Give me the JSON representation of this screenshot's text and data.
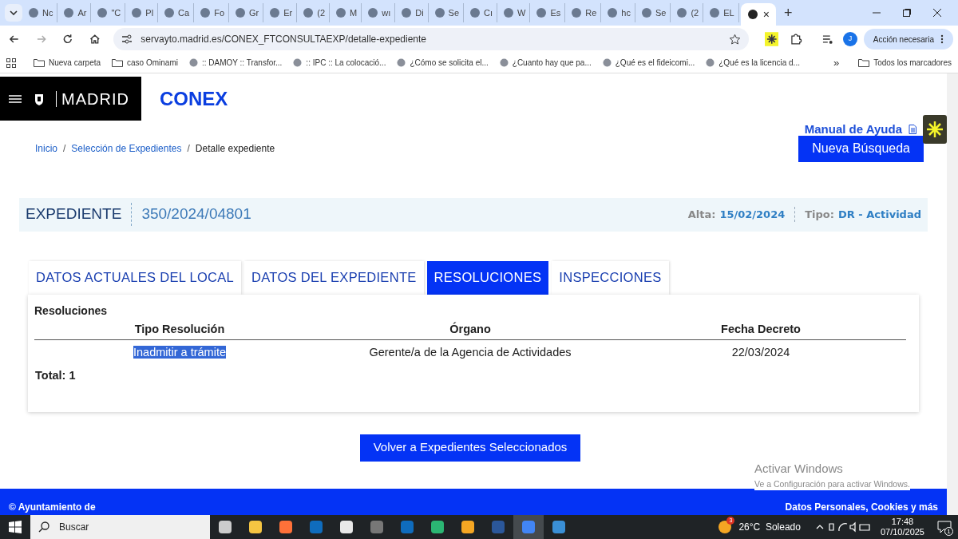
{
  "browser": {
    "tabs": [
      {
        "label": "Nc",
        "selected": false
      },
      {
        "label": "Ar",
        "selected": false
      },
      {
        "label": "\"C",
        "selected": false
      },
      {
        "label": "Pl",
        "selected": false
      },
      {
        "label": "Ca",
        "selected": false
      },
      {
        "label": "Fo",
        "selected": false
      },
      {
        "label": "Gr",
        "selected": false
      },
      {
        "label": "Er",
        "selected": false
      },
      {
        "label": "(2",
        "selected": false
      },
      {
        "label": "M",
        "selected": false
      },
      {
        "label": "wı",
        "selected": false
      },
      {
        "label": "Di",
        "selected": false
      },
      {
        "label": "Se",
        "selected": false
      },
      {
        "label": "Cı",
        "selected": false
      },
      {
        "label": "W",
        "selected": false
      },
      {
        "label": "Es",
        "selected": false
      },
      {
        "label": "Re",
        "selected": false
      },
      {
        "label": "hc",
        "selected": false
      },
      {
        "label": "Se",
        "selected": false
      },
      {
        "label": "(2",
        "selected": false
      },
      {
        "label": "EL",
        "selected": false
      },
      {
        "selected": true
      }
    ],
    "close_glyph": "×",
    "new_tab_glyph": "+",
    "url": "servayto.madrid.es/CONEX_FTCONSULTAEXP/detalle-expediente",
    "profile_initial": "J",
    "action_button": "Acción necesaria",
    "bookmarks": [
      "Nueva carpeta",
      "caso Ominami",
      ":: DAMOY :: Transfor...",
      ":: IPC :: La colocació...",
      "¿Cómo se solicita el...",
      "¿Cuanto hay que pa...",
      "¿Qué es el fideicomi...",
      "¿Qué es la licencia d..."
    ],
    "bookmarks_more": "»",
    "all_bookmarks": "Todos los marcadores"
  },
  "page": {
    "logo_text": "MADRID",
    "app_title": "CONEX",
    "help_link": "Manual de Ayuda",
    "breadcrumbs": [
      {
        "label": "Inicio",
        "current": false
      },
      {
        "label": "Selección de Expedientes",
        "current": false
      },
      {
        "label": "Detalle expediente",
        "current": true
      }
    ],
    "breadcrumb_separator": "/",
    "new_search_button": "Nueva Búsqueda",
    "expediente": {
      "label": "EXPEDIENTE",
      "number": "350/2024/04801",
      "alta_label": "Alta:",
      "alta_value": "15/02/2024",
      "tipo_label": "Tipo:",
      "tipo_value": "DR - Actividad"
    },
    "tabs": [
      {
        "label": "DATOS ACTUALES DEL LOCAL",
        "selected": false
      },
      {
        "label": "DATOS DEL EXPEDIENTE",
        "selected": false
      },
      {
        "label": "RESOLUCIONES",
        "selected": true
      },
      {
        "label": "INSPECCIONES",
        "selected": false
      }
    ],
    "panel": {
      "title": "Resoluciones",
      "table": {
        "columns": [
          "Tipo Resolución",
          "Órgano",
          "Fecha Decreto"
        ],
        "rows": [
          [
            {
              "text": "Inadmitir a trámite",
              "highlighted": true
            },
            {
              "text": "Gerente/a de la Agencia de Actividades",
              "highlighted": false
            },
            {
              "text": "22/03/2024",
              "highlighted": false
            }
          ]
        ]
      },
      "total": "Total: 1"
    },
    "back_button": "Volver a Expedientes Seleccionados",
    "footer_left": "© Ayuntamiento de",
    "footer_right": "Datos Personales, Cookies y más"
  },
  "activation_notice": {
    "title": "Activar Windows",
    "text": "Ve a Configuración para activar Windows."
  },
  "taskbar": {
    "search_placeholder": "Buscar",
    "weather_badge": "3",
    "weather": "26°C  Soleado",
    "time": "17:48",
    "date": "07/10/2025",
    "notifications": "1"
  }
}
